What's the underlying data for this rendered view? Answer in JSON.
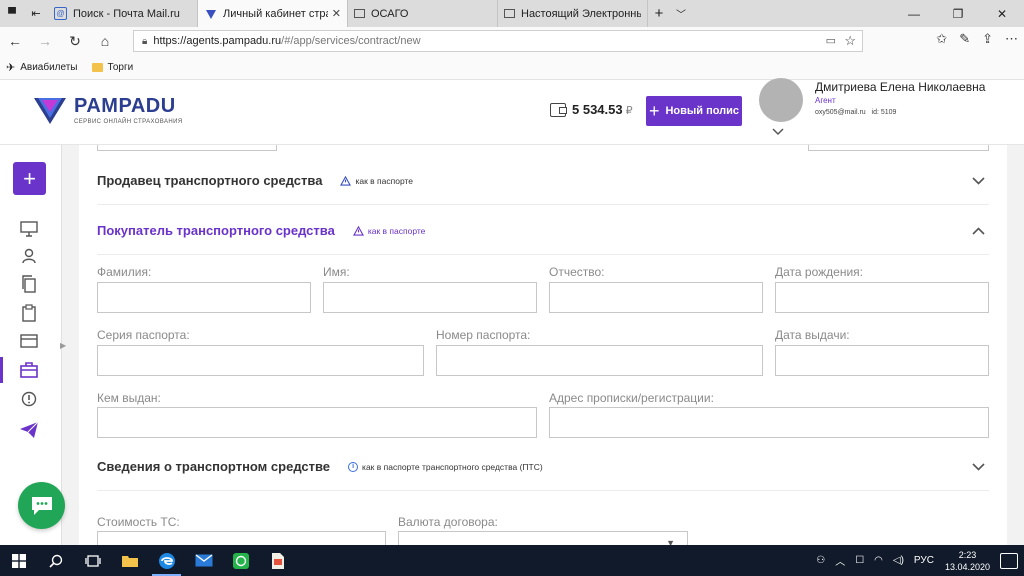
{
  "browser": {
    "tabs": [
      {
        "label": "Поиск - Почта Mail.ru",
        "active": false
      },
      {
        "label": "Личный кабинет страх",
        "active": true
      },
      {
        "label": "ОСАГО",
        "active": false
      },
      {
        "label": "Настоящий Электронный П",
        "active": false
      }
    ],
    "url_host": "https://agents.pampadu.ru",
    "url_path": "/#/app/services/contract/new",
    "bookmarks": [
      {
        "label": "Авиабилеты",
        "icon": "plane-icon"
      },
      {
        "label": "Торги",
        "icon": "folder-icon"
      }
    ]
  },
  "header": {
    "logo_word": "PAMPADU",
    "logo_sub": "сервис онлайн страхования",
    "balance": "5 534.53",
    "currency": "₽",
    "new_policy_label": "Новый полис",
    "user_name": "Дмитриева Елена Николаевна",
    "user_role": "Агент",
    "user_email": "oxy505@mail.ru",
    "user_id": "id: 5109"
  },
  "form": {
    "seller": {
      "title": "Продавец транспортного средства",
      "hint": "как в паспорте"
    },
    "buyer": {
      "title": "Покупатель транспортного средства",
      "hint": "как в паспорте",
      "fields": {
        "last_name": "Фамилия:",
        "first_name": "Имя:",
        "patronymic": "Отчество:",
        "birth_date": "Дата рождения:",
        "passport_series": "Серия паспорта:",
        "passport_number": "Номер паспорта:",
        "issue_date": "Дата выдачи:",
        "issued_by": "Кем выдан:",
        "address": "Адрес прописки/регистрации:"
      }
    },
    "vehicle": {
      "title": "Сведения о транспортном средстве",
      "hint": "как в паспорте транспортного средства (ПТС)",
      "fields": {
        "vehicle_cost": "Стоимость ТС:",
        "contract_currency": "Валюта договора:"
      }
    }
  },
  "taskbar": {
    "lang": "РУС",
    "time": "2:23",
    "date": "13.04.2020"
  },
  "colors": {
    "brand_purple": "#6a33c9",
    "logo_blue": "#2c3e8f",
    "chat_green": "#21a657"
  }
}
